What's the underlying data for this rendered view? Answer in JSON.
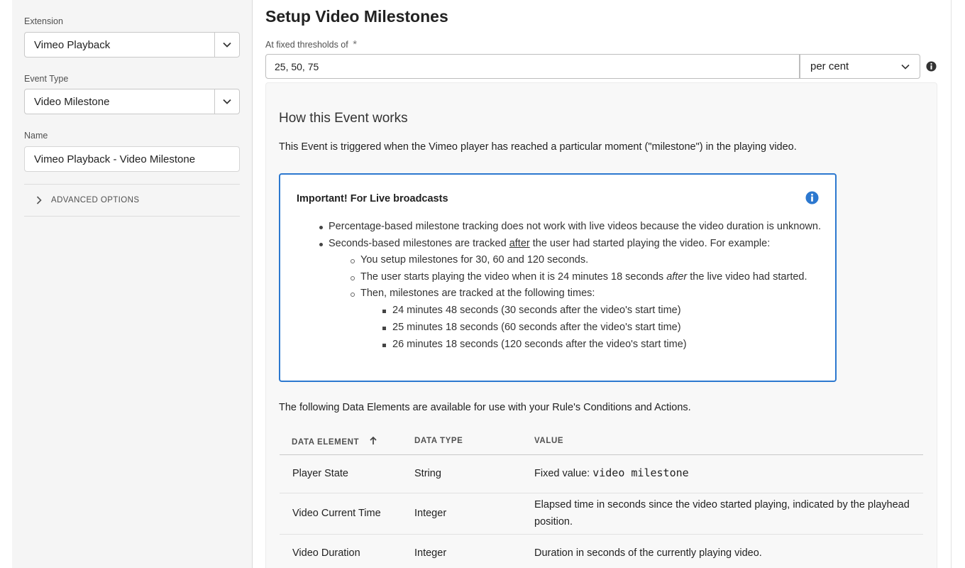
{
  "sidebar": {
    "extension": {
      "label": "Extension",
      "value": "Vimeo Playback"
    },
    "event_type": {
      "label": "Event Type",
      "value": "Video Milestone"
    },
    "name": {
      "label": "Name",
      "value": "Vimeo Playback - Video Milestone"
    },
    "advanced_options": "ADVANCED OPTIONS"
  },
  "main": {
    "title": "Setup Video Milestones",
    "thresholds": {
      "label": "At fixed thresholds of",
      "required_mark": "*",
      "value": "25, 50, 75",
      "unit": "per cent"
    },
    "how": {
      "title": "How this Event works",
      "description": "This Event is triggered when the Vimeo player has reached a particular moment (\"milestone\") in the playing video."
    },
    "notice": {
      "title": "Important! For Live broadcasts",
      "b1": "Percentage-based milestone tracking does not work with live videos because the video duration is unknown.",
      "b2_pre": "Seconds-based milestones are tracked ",
      "b2_em": "after",
      "b2_post": " the user had started playing the video. For example:",
      "s1": "You setup milestones for 30, 60 and 120 seconds.",
      "s2_pre": "The user starts playing the video when it is 24 minutes 18 seconds ",
      "s2_em": "after",
      "s2_post": " the live video had started.",
      "s3": "Then, milestones are tracked at the following times:",
      "t1": "24 minutes 48 seconds (30 seconds after the video's start time)",
      "t2": "25 minutes 18 seconds (60 seconds after the video's start time)",
      "t3": "26 minutes 18 seconds (120 seconds after the video's start time)"
    },
    "data_elements": {
      "intro": "The following Data Elements are available for use with your Rule's Conditions and Actions.",
      "headers": {
        "element": "DATA ELEMENT",
        "type": "DATA TYPE",
        "value": "VALUE"
      },
      "rows": [
        {
          "element": "Player State",
          "type": "String",
          "value_prefix": "Fixed value: ",
          "value_code": "video milestone"
        },
        {
          "element": "Video Current Time",
          "type": "Integer",
          "value_line1": "Elapsed time in seconds since the video started playing, indicated by the playhead",
          "value_line2": "position."
        },
        {
          "element": "Video Duration",
          "type": "Integer",
          "value": "Duration in seconds of the currently playing video."
        }
      ]
    }
  },
  "colors": {
    "accent": "#2c78cf",
    "sidebar_bg": "#f5f5f5",
    "panel_bg": "#f8f8f8"
  },
  "icons": [
    "chevron-down-icon",
    "chevron-right-icon",
    "info-icon",
    "arrow-up-icon"
  ]
}
